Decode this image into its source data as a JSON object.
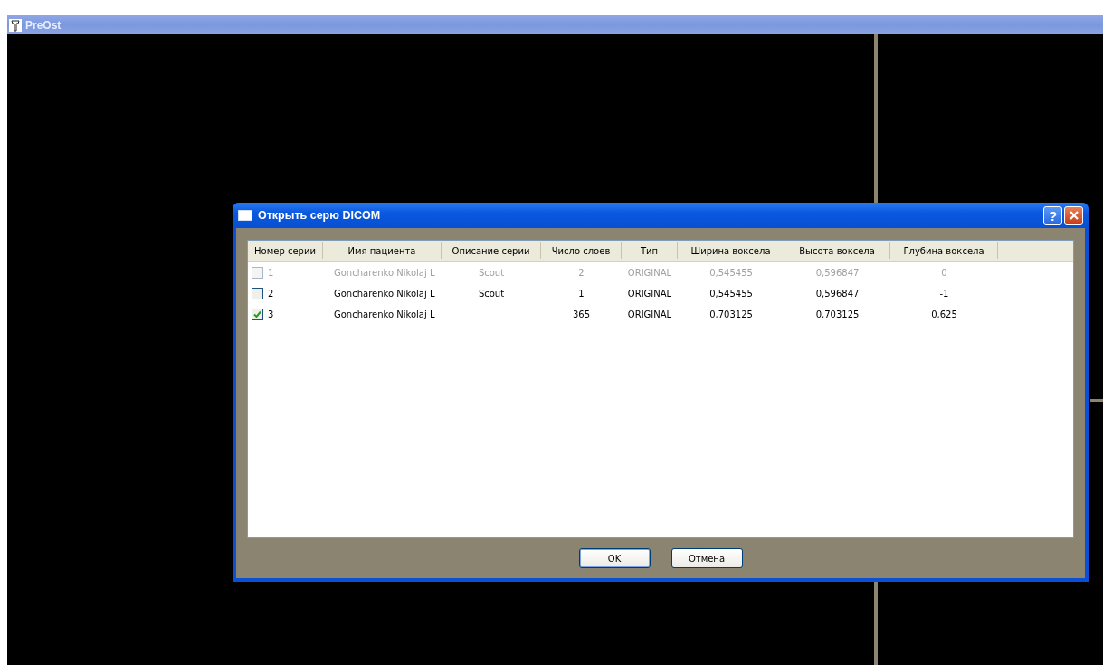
{
  "app": {
    "title": "PreOst"
  },
  "dialog": {
    "title": "Открыть серю DICOM",
    "help_label": "?",
    "columns": [
      "Номер серии",
      "Имя пациента",
      "Описание серии",
      "Число слоев",
      "Тип",
      "Ширина воксела",
      "Высота воксела",
      "Глубина воксела"
    ],
    "rows": [
      {
        "checked": false,
        "disabled": true,
        "cells": [
          "1",
          "Goncharenko Nikolaj L",
          "Scout",
          "2",
          "ORIGINAL",
          "0,545455",
          "0,596847",
          "0"
        ]
      },
      {
        "checked": false,
        "disabled": false,
        "cells": [
          "2",
          "Goncharenko Nikolaj L",
          "Scout",
          "1",
          "ORIGINAL",
          "0,545455",
          "0,596847",
          "-1"
        ]
      },
      {
        "checked": true,
        "disabled": false,
        "cells": [
          "3",
          "Goncharenko Nikolaj L",
          null,
          "365",
          "ORIGINAL",
          "0,703125",
          "0,703125",
          "0,625"
        ]
      }
    ],
    "buttons": [
      {
        "label": "OK",
        "default": true
      },
      {
        "label": "Отмена",
        "default": false
      }
    ]
  }
}
